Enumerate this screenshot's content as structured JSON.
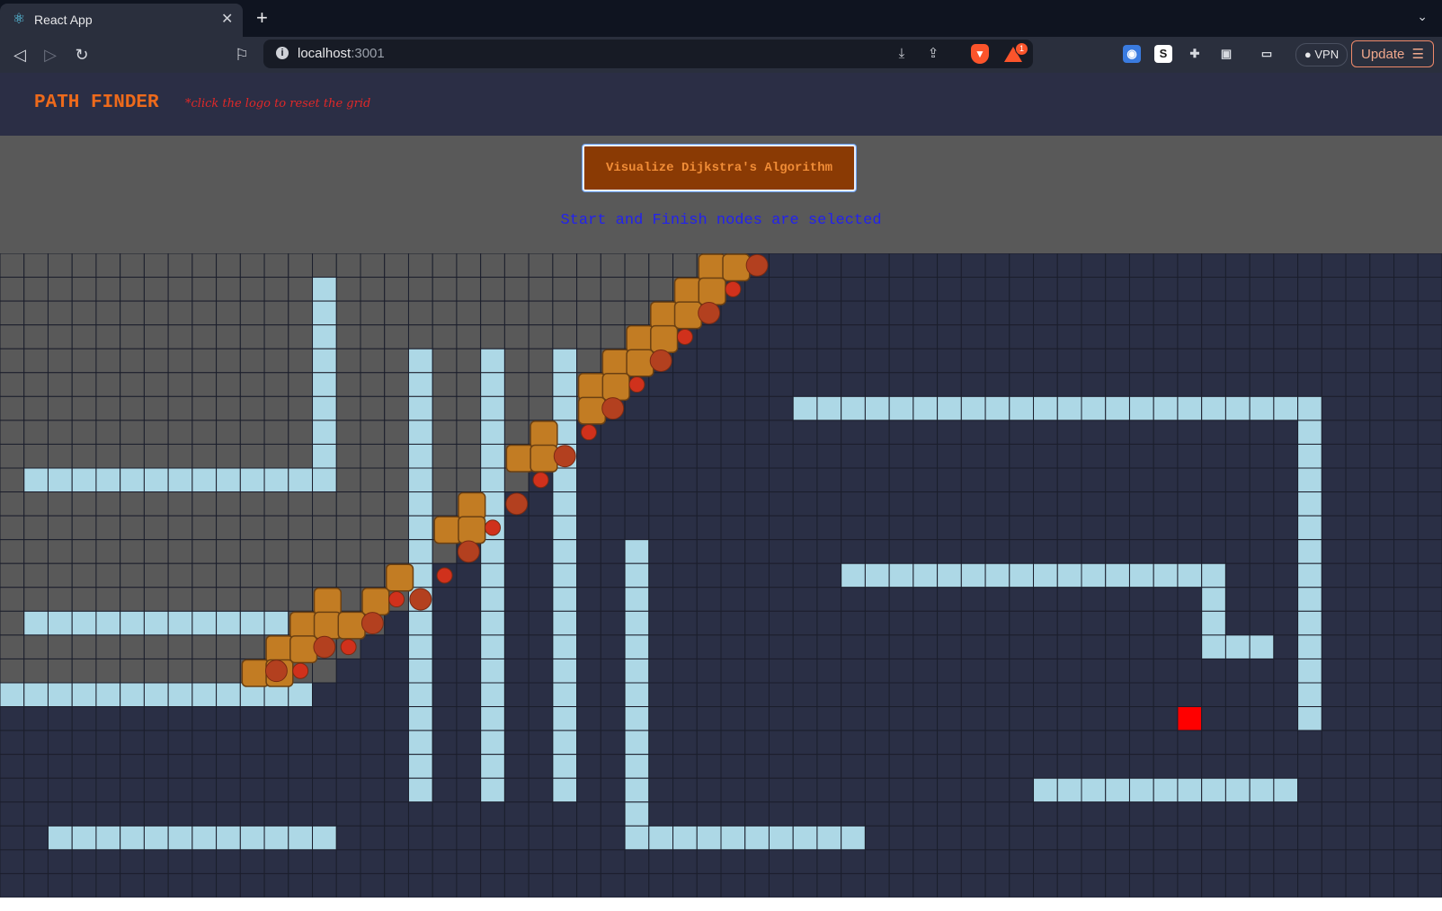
{
  "browser": {
    "tab_title": "React App",
    "tab_close": "✕",
    "new_tab": "+",
    "url_host": "localhost",
    "url_port": ":3001",
    "rewards_badge": "1",
    "vpn_label": "● VPN",
    "update_label": "Update"
  },
  "app": {
    "logo": "PATH FINDER",
    "hint": "*click the logo to reset the grid",
    "visualize_label": "Visualize Dijkstra's Algorithm",
    "status": "Start and Finish nodes are selected"
  },
  "colors": {
    "unvisited": "#2a2f45",
    "visited": "#595959",
    "wall": "#add8e6",
    "path": "#c27c23",
    "finish": "#ff0000"
  },
  "grid": {
    "rows": 27,
    "cols": 60,
    "walls": [
      [
        1,
        13
      ],
      [
        2,
        13
      ],
      [
        3,
        13
      ],
      [
        4,
        13
      ],
      [
        5,
        13
      ],
      [
        6,
        13
      ],
      [
        7,
        13
      ],
      [
        8,
        13
      ],
      [
        9,
        13
      ],
      [
        9,
        1
      ],
      [
        9,
        2
      ],
      [
        9,
        3
      ],
      [
        9,
        4
      ],
      [
        9,
        5
      ],
      [
        9,
        6
      ],
      [
        9,
        7
      ],
      [
        9,
        8
      ],
      [
        9,
        9
      ],
      [
        9,
        10
      ],
      [
        9,
        11
      ],
      [
        9,
        12
      ],
      [
        4,
        17
      ],
      [
        5,
        17
      ],
      [
        6,
        17
      ],
      [
        7,
        17
      ],
      [
        8,
        17
      ],
      [
        9,
        17
      ],
      [
        10,
        17
      ],
      [
        11,
        17
      ],
      [
        12,
        17
      ],
      [
        13,
        17
      ],
      [
        14,
        17
      ],
      [
        15,
        17
      ],
      [
        16,
        17
      ],
      [
        17,
        17
      ],
      [
        18,
        17
      ],
      [
        19,
        17
      ],
      [
        20,
        17
      ],
      [
        21,
        17
      ],
      [
        22,
        17
      ],
      [
        4,
        20
      ],
      [
        5,
        20
      ],
      [
        6,
        20
      ],
      [
        7,
        20
      ],
      [
        8,
        20
      ],
      [
        9,
        20
      ],
      [
        10,
        20
      ],
      [
        11,
        20
      ],
      [
        12,
        20
      ],
      [
        13,
        20
      ],
      [
        14,
        20
      ],
      [
        15,
        20
      ],
      [
        16,
        20
      ],
      [
        17,
        20
      ],
      [
        18,
        20
      ],
      [
        19,
        20
      ],
      [
        20,
        20
      ],
      [
        21,
        20
      ],
      [
        22,
        20
      ],
      [
        4,
        23
      ],
      [
        5,
        23
      ],
      [
        6,
        23
      ],
      [
        7,
        23
      ],
      [
        8,
        23
      ],
      [
        9,
        23
      ],
      [
        10,
        23
      ],
      [
        11,
        23
      ],
      [
        12,
        23
      ],
      [
        13,
        23
      ],
      [
        14,
        23
      ],
      [
        15,
        23
      ],
      [
        16,
        23
      ],
      [
        17,
        23
      ],
      [
        18,
        23
      ],
      [
        19,
        23
      ],
      [
        20,
        23
      ],
      [
        21,
        23
      ],
      [
        22,
        23
      ],
      [
        15,
        1
      ],
      [
        15,
        2
      ],
      [
        15,
        3
      ],
      [
        15,
        4
      ],
      [
        15,
        5
      ],
      [
        15,
        6
      ],
      [
        15,
        7
      ],
      [
        15,
        8
      ],
      [
        15,
        9
      ],
      [
        15,
        10
      ],
      [
        15,
        11
      ],
      [
        18,
        0
      ],
      [
        18,
        1
      ],
      [
        18,
        2
      ],
      [
        18,
        3
      ],
      [
        18,
        4
      ],
      [
        18,
        5
      ],
      [
        18,
        6
      ],
      [
        18,
        7
      ],
      [
        18,
        8
      ],
      [
        18,
        9
      ],
      [
        18,
        10
      ],
      [
        18,
        11
      ],
      [
        18,
        12
      ],
      [
        24,
        2
      ],
      [
        24,
        3
      ],
      [
        24,
        4
      ],
      [
        24,
        5
      ],
      [
        24,
        6
      ],
      [
        24,
        7
      ],
      [
        24,
        8
      ],
      [
        24,
        9
      ],
      [
        24,
        10
      ],
      [
        24,
        11
      ],
      [
        24,
        12
      ],
      [
        24,
        13
      ],
      [
        12,
        26
      ],
      [
        13,
        26
      ],
      [
        14,
        26
      ],
      [
        15,
        26
      ],
      [
        16,
        26
      ],
      [
        17,
        26
      ],
      [
        18,
        26
      ],
      [
        19,
        26
      ],
      [
        20,
        26
      ],
      [
        21,
        26
      ],
      [
        22,
        26
      ],
      [
        23,
        26
      ],
      [
        24,
        26
      ],
      [
        24,
        27
      ],
      [
        24,
        28
      ],
      [
        24,
        29
      ],
      [
        24,
        30
      ],
      [
        24,
        31
      ],
      [
        24,
        32
      ],
      [
        24,
        33
      ],
      [
        24,
        34
      ],
      [
        24,
        35
      ],
      [
        6,
        33
      ],
      [
        6,
        34
      ],
      [
        6,
        35
      ],
      [
        6,
        36
      ],
      [
        6,
        37
      ],
      [
        6,
        38
      ],
      [
        6,
        39
      ],
      [
        6,
        40
      ],
      [
        6,
        41
      ],
      [
        6,
        42
      ],
      [
        6,
        43
      ],
      [
        6,
        44
      ],
      [
        6,
        45
      ],
      [
        6,
        46
      ],
      [
        6,
        47
      ],
      [
        6,
        48
      ],
      [
        6,
        49
      ],
      [
        6,
        50
      ],
      [
        6,
        51
      ],
      [
        6,
        52
      ],
      [
        6,
        53
      ],
      [
        6,
        54
      ],
      [
        7,
        54
      ],
      [
        8,
        54
      ],
      [
        9,
        54
      ],
      [
        10,
        54
      ],
      [
        11,
        54
      ],
      [
        12,
        54
      ],
      [
        13,
        54
      ],
      [
        14,
        54
      ],
      [
        15,
        54
      ],
      [
        16,
        54
      ],
      [
        17,
        54
      ],
      [
        18,
        54
      ],
      [
        19,
        54
      ],
      [
        13,
        35
      ],
      [
        13,
        36
      ],
      [
        13,
        37
      ],
      [
        13,
        38
      ],
      [
        13,
        39
      ],
      [
        13,
        40
      ],
      [
        13,
        41
      ],
      [
        13,
        42
      ],
      [
        13,
        43
      ],
      [
        13,
        44
      ],
      [
        13,
        45
      ],
      [
        13,
        46
      ],
      [
        13,
        47
      ],
      [
        13,
        48
      ],
      [
        13,
        49
      ],
      [
        13,
        50
      ],
      [
        14,
        50
      ],
      [
        15,
        50
      ],
      [
        16,
        50
      ],
      [
        16,
        51
      ],
      [
        16,
        52
      ],
      [
        22,
        43
      ],
      [
        22,
        44
      ],
      [
        22,
        45
      ],
      [
        22,
        46
      ],
      [
        22,
        47
      ],
      [
        22,
        48
      ],
      [
        22,
        49
      ],
      [
        22,
        50
      ],
      [
        22,
        51
      ],
      [
        22,
        52
      ],
      [
        22,
        53
      ]
    ],
    "path": [
      [
        0,
        29
      ],
      [
        0,
        30
      ],
      [
        1,
        28
      ],
      [
        1,
        29
      ],
      [
        2,
        27
      ],
      [
        2,
        28
      ],
      [
        3,
        26
      ],
      [
        3,
        27
      ],
      [
        4,
        25
      ],
      [
        4,
        26
      ],
      [
        5,
        24
      ],
      [
        5,
        25
      ],
      [
        6,
        24
      ],
      [
        7,
        22
      ],
      [
        8,
        21
      ],
      [
        8,
        22
      ],
      [
        10,
        19
      ],
      [
        11,
        18
      ],
      [
        11,
        19
      ],
      [
        13,
        16
      ],
      [
        14,
        13
      ],
      [
        14,
        15
      ],
      [
        15,
        12
      ],
      [
        15,
        13
      ],
      [
        15,
        14
      ],
      [
        16,
        11
      ],
      [
        16,
        12
      ],
      [
        17,
        10
      ],
      [
        17,
        11
      ]
    ],
    "frontier": [
      [
        0,
        31
      ],
      [
        1,
        30
      ],
      [
        2,
        29
      ],
      [
        3,
        28
      ],
      [
        4,
        27
      ],
      [
        5,
        26
      ],
      [
        6,
        25
      ],
      [
        7,
        24
      ],
      [
        8,
        23
      ],
      [
        9,
        22
      ],
      [
        10,
        21
      ],
      [
        11,
        20
      ],
      [
        12,
        19
      ],
      [
        13,
        18
      ],
      [
        14,
        17
      ],
      [
        14,
        16
      ],
      [
        15,
        15
      ],
      [
        16,
        14
      ],
      [
        16,
        13
      ],
      [
        17,
        12
      ],
      [
        17,
        11
      ]
    ],
    "finish": [
      19,
      49
    ],
    "visited_boundary": [
      [
        0,
        31
      ],
      [
        1,
        30
      ],
      [
        2,
        29
      ],
      [
        3,
        28
      ],
      [
        4,
        27
      ],
      [
        5,
        26
      ],
      [
        6,
        25
      ],
      [
        7,
        24
      ],
      [
        8,
        23
      ],
      [
        9,
        22
      ],
      [
        10,
        21
      ],
      [
        11,
        20
      ],
      [
        12,
        19
      ],
      [
        13,
        18
      ],
      [
        14,
        17
      ],
      [
        15,
        16
      ],
      [
        16,
        15
      ],
      [
        17,
        14
      ],
      [
        18,
        13
      ]
    ]
  }
}
